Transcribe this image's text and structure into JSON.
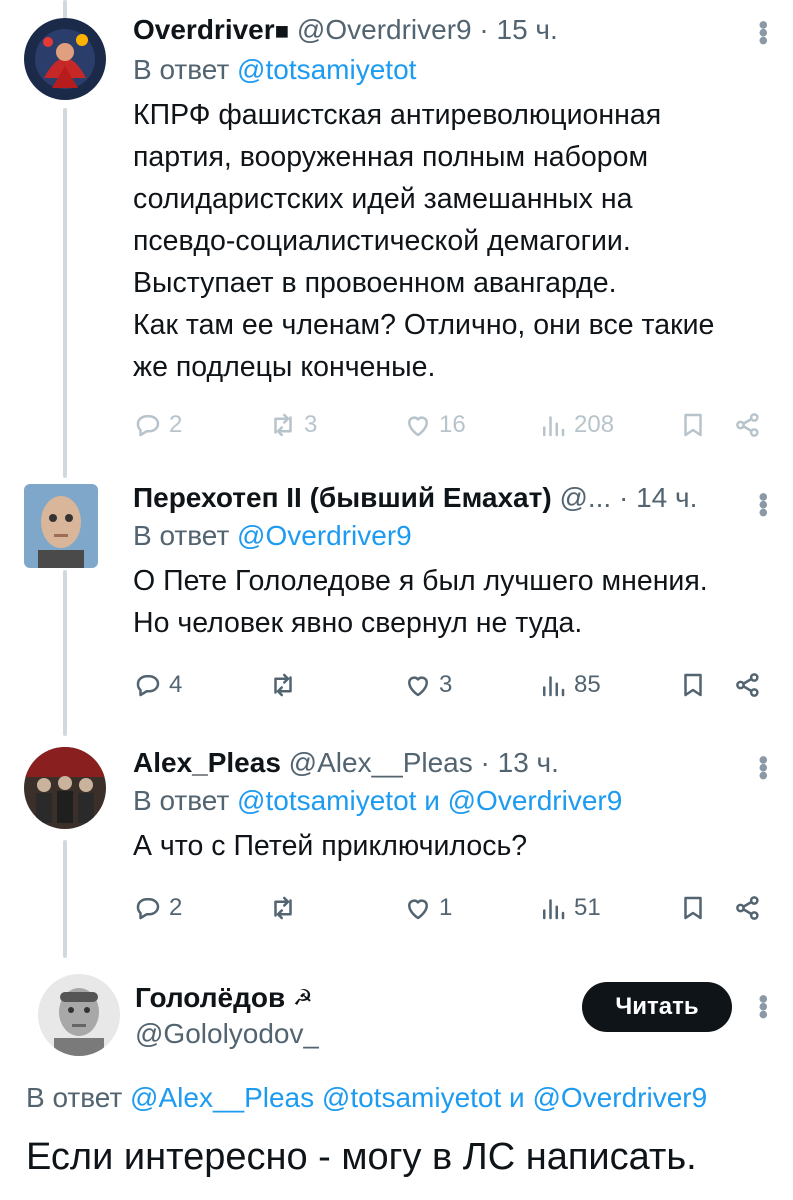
{
  "tweets": [
    {
      "name": "Overdriver",
      "name_suffix": "■",
      "handle": "@Overdriver9",
      "time": "· 15 ч.",
      "reply_prefix": "В ответ",
      "reply_links": "@totsamiyetot",
      "text": [
        "КПРФ фашистская антиреволюционная",
        "партия, вооруженная полным набором",
        "солидаристских идей замешанных на",
        "псевдо-социалистической демагогии.",
        "Выступает в провоенном авангарде.",
        "Как там ее членам? Отлично, они все такие",
        "же подлецы конченые."
      ],
      "replies": "2",
      "retweets": "3",
      "likes": "16",
      "views": "208"
    },
    {
      "name": "Перехотеп II (бывший Емахат)",
      "handle": "@...",
      "time": "· 14 ч.",
      "reply_prefix": "В ответ",
      "reply_links": "@Overdriver9",
      "text": [
        "О Пете Гололедове я был лучшего мнения.",
        "Но человек явно свернул не туда."
      ],
      "replies": "4",
      "retweets": "",
      "likes": "3",
      "views": "85"
    },
    {
      "name": "Alex_Pleas",
      "handle": "@Alex__Pleas",
      "time": "· 13 ч.",
      "reply_prefix": "В ответ",
      "reply_links": "@totsamiyetot и @Overdriver9",
      "text": [
        "А что с Петей приключилось?"
      ],
      "replies": "2",
      "retweets": "",
      "likes": "1",
      "views": "51"
    }
  ],
  "main": {
    "name": "Гололёдов",
    "name_emoji": "☭",
    "handle": "@Gololyodov_",
    "follow_label": "Читать",
    "reply_prefix": "В ответ",
    "reply_links": "@Alex__Pleas @totsamiyetot и @Overdriver9",
    "text": "Если интересно - могу в ЛС написать."
  },
  "colors": {
    "link": "#1d9bf0",
    "secondary": "#536471",
    "thread": "#cfd9de"
  },
  "icons": [
    "reply-icon",
    "retweet-icon",
    "like-icon",
    "views-icon",
    "bookmark-icon",
    "share-icon",
    "more-icon"
  ]
}
